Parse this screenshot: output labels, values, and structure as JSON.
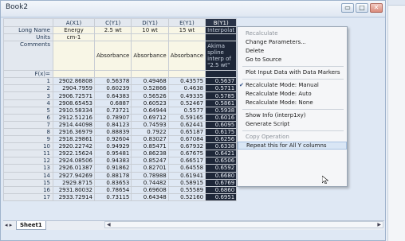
{
  "window": {
    "title": "Book2"
  },
  "columns": [
    {
      "header": "A(X1)",
      "long_name": "Energy",
      "units": "cm-1",
      "comment": "",
      "fx": ""
    },
    {
      "header": "C(Y1)",
      "long_name": "2.5 wt",
      "units": "",
      "comment": "Absorbance",
      "fx": ""
    },
    {
      "header": "D(Y1)",
      "long_name": "10 wt",
      "units": "",
      "comment": "Absorbance",
      "fx": ""
    },
    {
      "header": "E(Y1)",
      "long_name": "15 wt",
      "units": "",
      "comment": "Absorbance",
      "fx": ""
    },
    {
      "header": "B(Y1)",
      "long_name": "Interpolat",
      "units": "",
      "comment": "Akima spline interp of \"2.5 wt\"",
      "fx": ""
    }
  ],
  "row_labels": {
    "long_name": "Long Name",
    "units": "Units",
    "comments": "Comments",
    "fx": "F(x)="
  },
  "rows": [
    {
      "n": "1",
      "cells": [
        "2902.86808",
        "0.56378",
        "0.49468",
        "0.43575",
        "0.5637"
      ]
    },
    {
      "n": "2",
      "cells": [
        "2904.7959",
        "0.60239",
        "0.52866",
        "0.4638",
        "0.5711"
      ]
    },
    {
      "n": "3",
      "cells": [
        "2906.72571",
        "0.64383",
        "0.56526",
        "0.49335",
        "0.5785"
      ]
    },
    {
      "n": "4",
      "cells": [
        "2908.65453",
        "0.6887",
        "0.60523",
        "0.52467",
        "0.5861"
      ]
    },
    {
      "n": "5",
      "cells": [
        "2910.58334",
        "0.73721",
        "0.64944",
        "0.5577",
        "0.5938"
      ]
    },
    {
      "n": "6",
      "cells": [
        "2912.51216",
        "0.78907",
        "0.69712",
        "0.59165",
        "0.6016"
      ]
    },
    {
      "n": "7",
      "cells": [
        "2914.44098",
        "0.84123",
        "0.74593",
        "0.62441",
        "0.6095"
      ]
    },
    {
      "n": "8",
      "cells": [
        "2916.36979",
        "0.88839",
        "0.7922",
        "0.65187",
        "0.6175"
      ]
    },
    {
      "n": "9",
      "cells": [
        "2918.29861",
        "0.92604",
        "0.83027",
        "0.67084",
        "0.6256"
      ]
    },
    {
      "n": "10",
      "cells": [
        "2920.22742",
        "0.94929",
        "0.85471",
        "0.67932",
        "0.6338"
      ]
    },
    {
      "n": "11",
      "cells": [
        "2922.15624",
        "0.95481",
        "0.86238",
        "0.67675",
        "0.6421"
      ]
    },
    {
      "n": "12",
      "cells": [
        "2924.08506",
        "0.94383",
        "0.85247",
        "0.66517",
        "0.6506"
      ]
    },
    {
      "n": "13",
      "cells": [
        "2926.01387",
        "0.91862",
        "0.82701",
        "0.64558",
        "0.6592"
      ]
    },
    {
      "n": "14",
      "cells": [
        "2927.94269",
        "0.88178",
        "0.78988",
        "0.61941",
        "0.6680"
      ]
    },
    {
      "n": "15",
      "cells": [
        "2929.8715",
        "0.83653",
        "0.74482",
        "0.58915",
        "0.6769"
      ]
    },
    {
      "n": "16",
      "cells": [
        "2931.80032",
        "0.78654",
        "0.69608",
        "0.55589",
        "0.6860"
      ]
    },
    {
      "n": "17",
      "cells": [
        "2933.72914",
        "0.73115",
        "0.64348",
        "0.52160",
        "0.6951"
      ]
    }
  ],
  "sheet_tab": {
    "nav": "◂ ▸",
    "label": "Sheet1"
  },
  "context_menu": [
    {
      "label": "Recalculate",
      "disabled": true
    },
    {
      "label": "Change Parameters..."
    },
    {
      "label": "Delete"
    },
    {
      "label": "Go to Source"
    },
    {
      "separator": true
    },
    {
      "label": "Plot Input Data with Data Markers"
    },
    {
      "separator": true
    },
    {
      "label": "Recalculate Mode: Manual",
      "checked": true
    },
    {
      "label": "Recalculate Mode: Auto"
    },
    {
      "label": "Recalculate Mode: None"
    },
    {
      "separator": true
    },
    {
      "label": "Show Info (interp1xy)"
    },
    {
      "label": "Generate Script"
    },
    {
      "separator": true
    },
    {
      "label": "Copy Operation",
      "disabled": true
    },
    {
      "label": "Repeat this for All Y columns",
      "hover": true
    }
  ],
  "colors": {
    "selected_column_bg": "#1e2738",
    "label_row_bg": "#f8f6e6",
    "menu_hover": "#d9e6f5"
  }
}
